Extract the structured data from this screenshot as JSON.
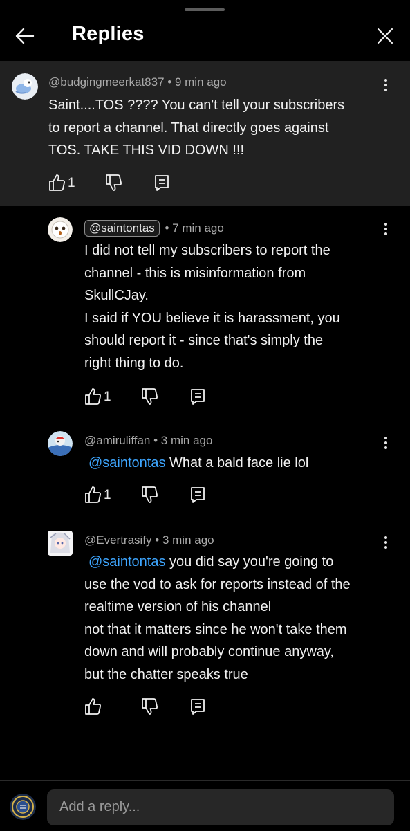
{
  "header": {
    "title": "Replies"
  },
  "parent": {
    "handle": "@budgingmeerkat837",
    "time": "9 min ago",
    "text": "Saint....TOS ???? You can't tell your subscribers\nto report a channel. That directly goes against\nTOS. TAKE THIS VID DOWN !!!",
    "like_count": "1"
  },
  "replies": [
    {
      "handle": "@saintontas",
      "time": "7 min ago",
      "mention": "",
      "text": "I did not tell my subscribers to report the\nchannel - this is misinformation from\nSkullCJay.\nI said if YOU believe it is harassment, you\nshould report it - since that's simply the\nright thing to do.",
      "like_count": "1"
    },
    {
      "handle": "@amiruliffan",
      "time": "3 min ago",
      "mention": "@saintontas",
      "text": "What a bald face lie lol",
      "like_count": "1"
    },
    {
      "handle": "@Evertrasify",
      "time": "3 min ago",
      "mention": "@saintontas",
      "text": " you did say you're going to\nuse the vod to ask for reports instead of the\nrealtime version of his channel\nnot that it matters since he won't take them\ndown and will probably continue anyway,\nbut the chatter speaks true",
      "like_count": ""
    }
  ],
  "footer": {
    "placeholder": "Add a reply..."
  },
  "icons": {
    "back": "arrow-left-icon",
    "close": "close-icon",
    "like": "thumbs-up-icon",
    "dislike": "thumbs-down-icon",
    "reply": "reply-icon",
    "more": "more-vertical-icon"
  },
  "colors": {
    "background": "#000000",
    "parent_background": "#212121",
    "mention": "#3ea6ff",
    "secondary_text": "#aaaaaa"
  }
}
